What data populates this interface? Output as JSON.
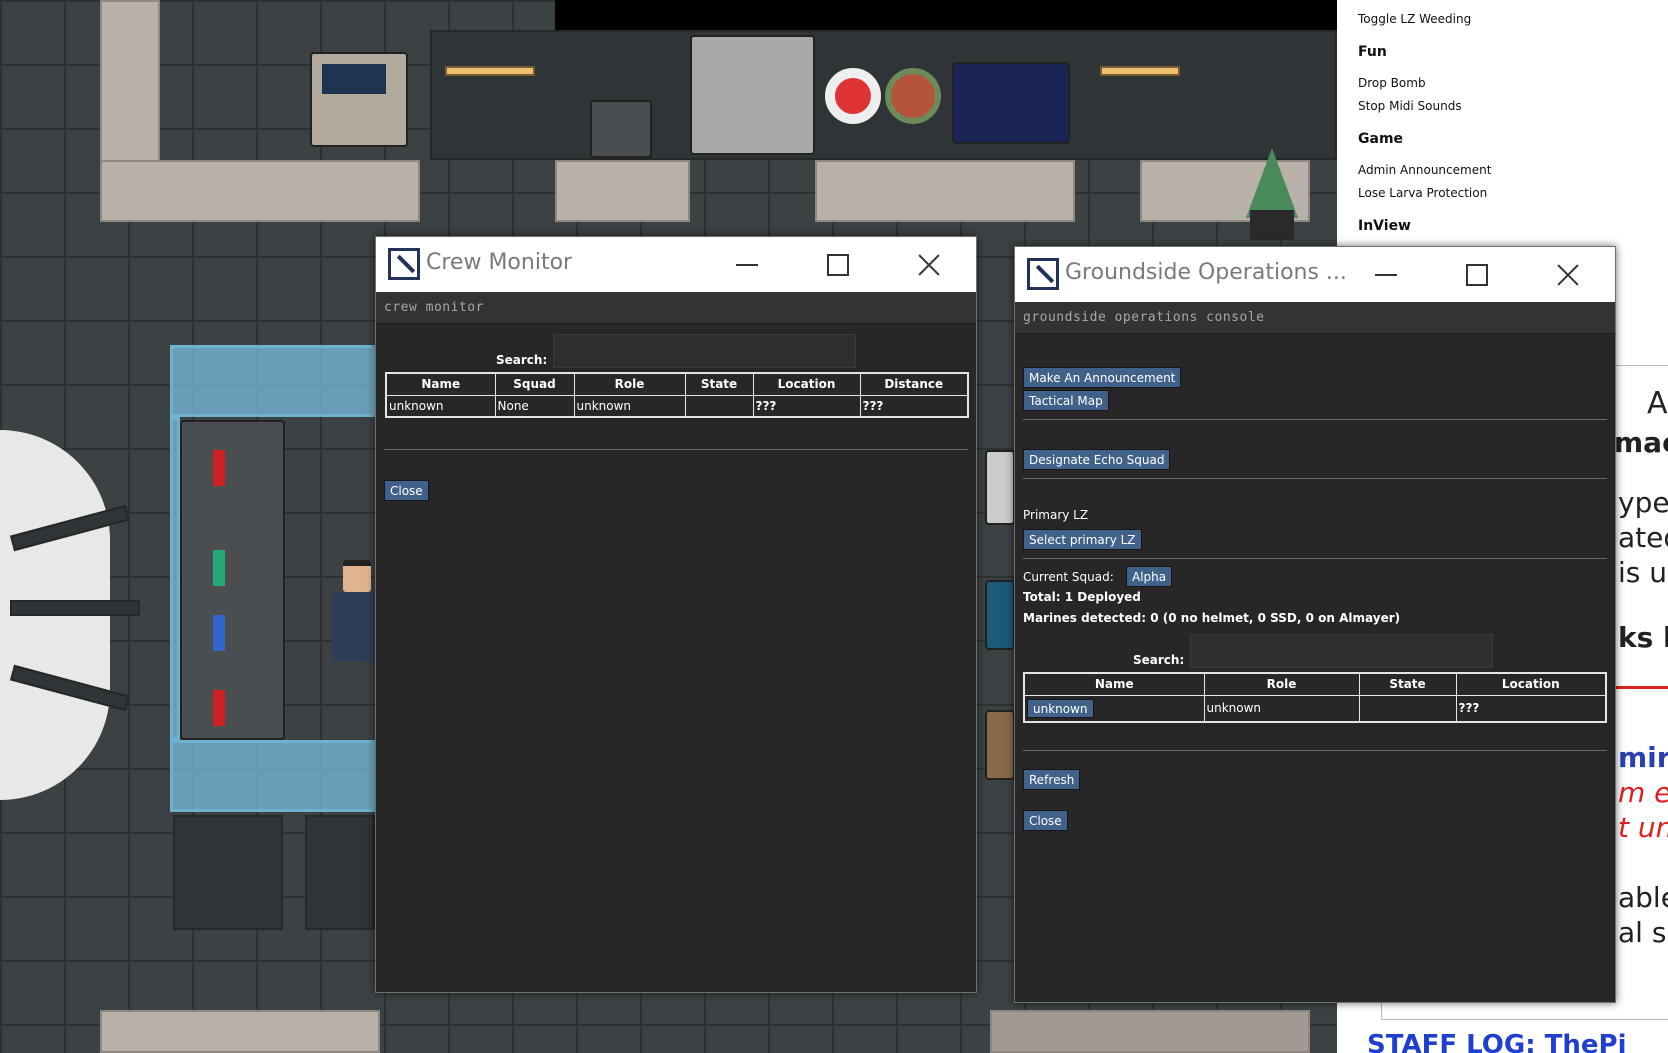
{
  "sidepanel": {
    "items": [
      {
        "label": "Toggle LZ Weeding",
        "type": "item"
      },
      {
        "label": "Fun",
        "type": "category"
      },
      {
        "label": "Drop Bomb",
        "type": "item"
      },
      {
        "label": "Stop Midi Sounds",
        "type": "item"
      },
      {
        "label": "Game",
        "type": "category"
      },
      {
        "label": "Admin Announcement",
        "type": "item"
      },
      {
        "label": "Lose Larva Protection",
        "type": "item"
      },
      {
        "label": "InView",
        "type": "category"
      }
    ],
    "browser_fragments": [
      "A",
      "mac",
      "yper",
      "ated",
      "is u",
      "ks b",
      "mir",
      "m ev",
      "t un",
      "able",
      "al su",
      "STAFF LOG: ThePi"
    ]
  },
  "crew_monitor": {
    "title": "Crew Monitor",
    "header": "crew monitor",
    "search_label": "Search:",
    "search_value": "",
    "columns": [
      "Name",
      "Squad",
      "Role",
      "State",
      "Location",
      "Distance"
    ],
    "rows": [
      {
        "name": "unknown",
        "squad": "None",
        "role": "unknown",
        "state": "",
        "location": "???",
        "distance": "???"
      }
    ],
    "close_label": "Close"
  },
  "groundside": {
    "title": "Groundside Operations ...",
    "header": "groundside operations console",
    "announce_label": "Make An Announcement",
    "tactical_label": "Tactical Map",
    "echo_label": "Designate Echo Squad",
    "primary_lz_label": "Primary LZ",
    "select_lz_label": "Select primary LZ",
    "current_squad_label": "Current Squad:",
    "current_squad_value": "Alpha",
    "total_text": "Total: 1 Deployed",
    "marines_text": "Marines detected: 0 (0 no helmet, 0 SSD, 0 on Almayer)",
    "search_label": "Search:",
    "search_value": "",
    "columns": [
      "Name",
      "Role",
      "State",
      "Location"
    ],
    "rows": [
      {
        "name": "unknown",
        "role": "unknown",
        "state": "",
        "location": "???"
      }
    ],
    "refresh_label": "Refresh",
    "close_label": "Close"
  }
}
